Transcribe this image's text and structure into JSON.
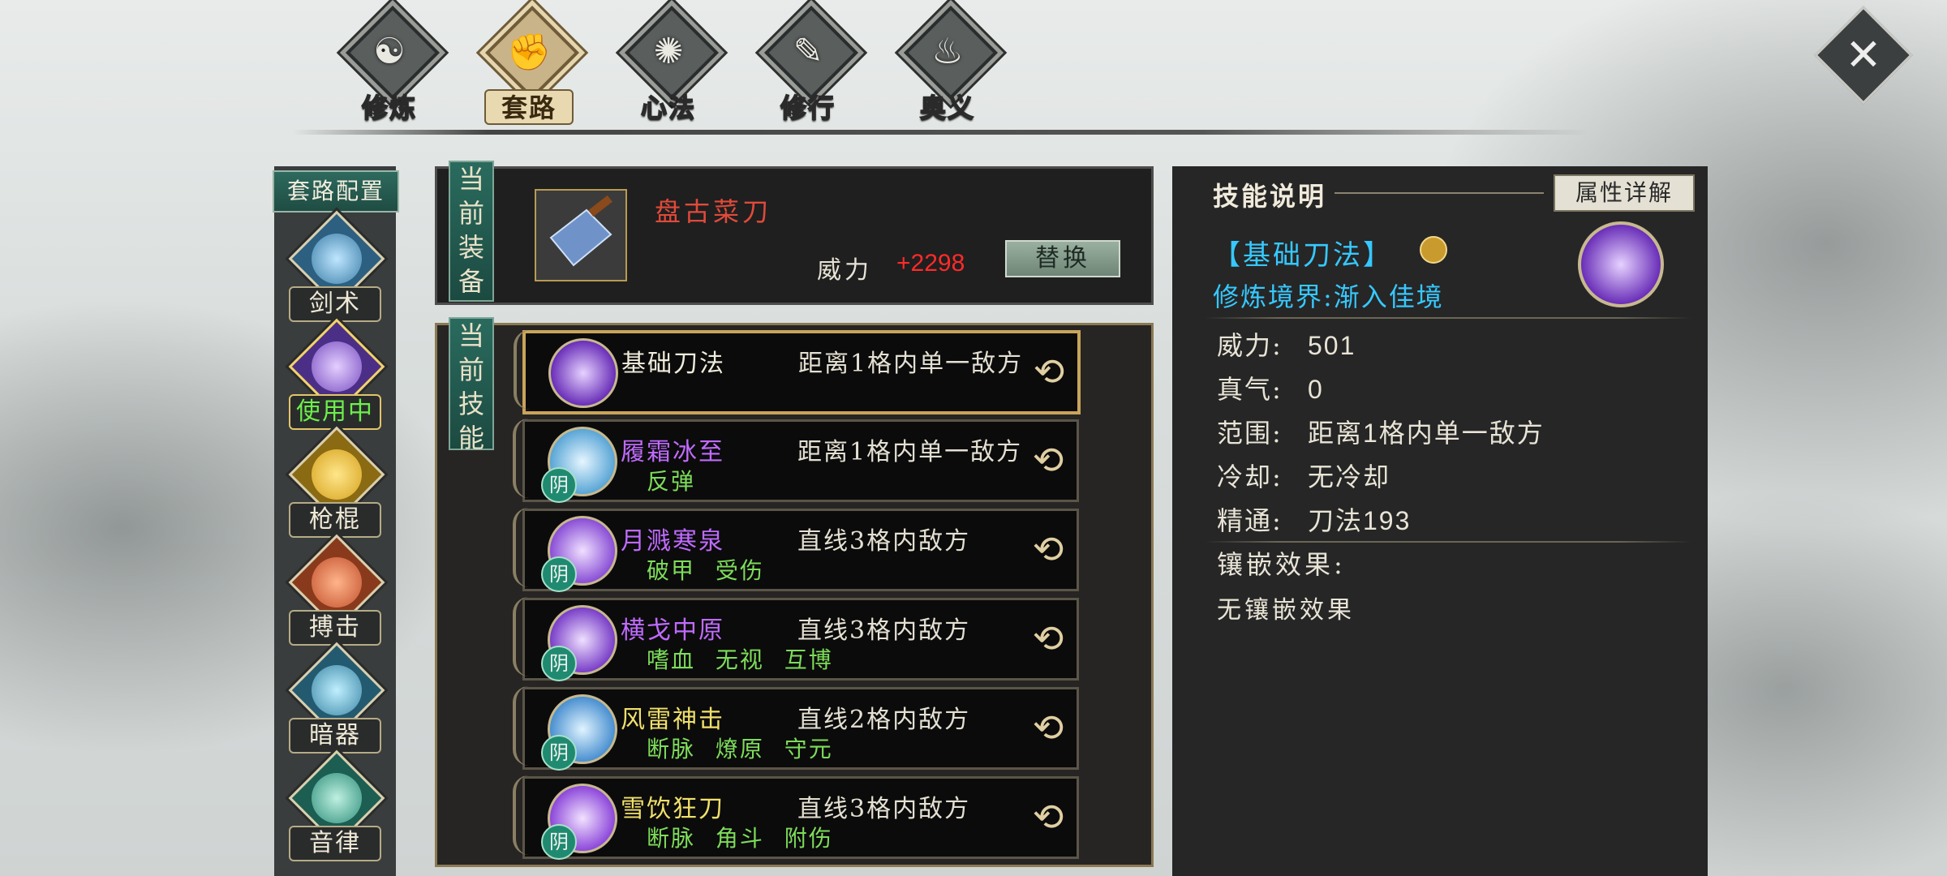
{
  "nav": {
    "tabs": [
      {
        "label": "修炼",
        "icon": "taiji-icon",
        "active": false
      },
      {
        "label": "套路",
        "icon": "fist-icon",
        "active": true
      },
      {
        "label": "心法",
        "icon": "swirl-icon",
        "active": false
      },
      {
        "label": "修行",
        "icon": "scroll-icon",
        "active": false
      },
      {
        "label": "奥义",
        "icon": "flame-icon",
        "active": false
      }
    ],
    "close_icon": "close-icon"
  },
  "sidebar": {
    "title": "套路配置",
    "items": [
      {
        "label": "剑术",
        "color": "#3c7fa8"
      },
      {
        "label": "使用中",
        "color": "#7a4fc2",
        "active": true
      },
      {
        "label": "枪棍",
        "color": "#d6a21e"
      },
      {
        "label": "搏击",
        "color": "#c2512e"
      },
      {
        "label": "暗器",
        "color": "#3d88a6"
      },
      {
        "label": "音律",
        "color": "#2f8f7c"
      }
    ]
  },
  "equipment": {
    "section_label": "当前装备",
    "name": "盘古菜刀",
    "power_label": "威力",
    "power_value": "+2298",
    "replace_label": "替换"
  },
  "skills": {
    "section_label": "当前技能",
    "yin_label": "阴",
    "list": [
      {
        "name": "基础刀法",
        "name_color": "#f0ecdc",
        "range": "距离1格内单一敌方",
        "tags": "",
        "yin": false,
        "selected": true
      },
      {
        "name": "履霜冰至",
        "name_color": "#c06bff",
        "range": "距离1格内单一敌方",
        "tags": "反弹",
        "yin": true
      },
      {
        "name": "月溅寒泉",
        "name_color": "#c06bff",
        "range": "直线3格内敌方",
        "tags": "破甲 受伤",
        "yin": true
      },
      {
        "name": "横戈中原",
        "name_color": "#c06bff",
        "range": "直线3格内敌方",
        "tags": "嗜血 无视 互博",
        "yin": true
      },
      {
        "name": "风雷神击",
        "name_color": "#f0e06a",
        "range": "直线2格内敌方",
        "tags": "断脉 燎原 守元",
        "yin": true
      },
      {
        "name": "雪饮狂刀",
        "name_color": "#f0e06a",
        "range": "直线3格内敌方",
        "tags": "断脉 角斗 附伤",
        "yin": true
      }
    ]
  },
  "description": {
    "title": "技能说明",
    "attr_button": "属性详解",
    "skill_name": "【基础刀法】",
    "realm": "修炼境界:渐入佳境",
    "stats": [
      {
        "k": "威力:",
        "v": "501"
      },
      {
        "k": "真气:",
        "v": "0"
      },
      {
        "k": "范围:",
        "v": "距离1格内单一敌方"
      },
      {
        "k": "冷却:",
        "v": "无冷却"
      },
      {
        "k": "精通:",
        "v": "刀法193"
      }
    ],
    "inlay_heading": "镶嵌效果:",
    "inlay_value": "无镶嵌效果"
  }
}
